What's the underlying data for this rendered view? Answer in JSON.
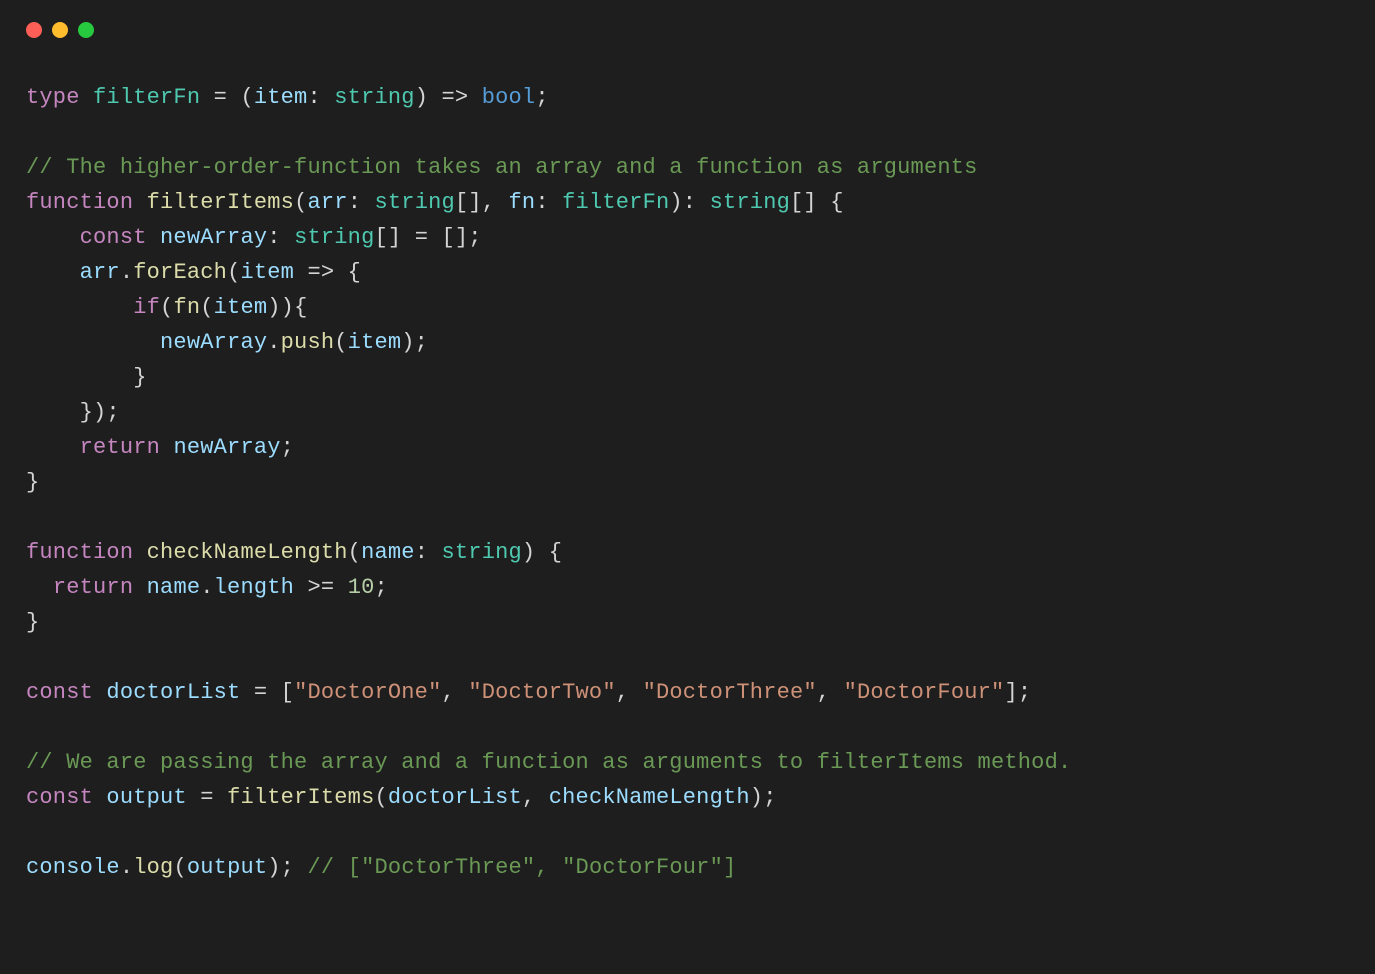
{
  "window": {
    "dots": [
      "red",
      "yellow",
      "green"
    ]
  },
  "code": {
    "tokens": [
      [
        {
          "t": "type",
          "c": "kw"
        },
        {
          "t": " ",
          "c": "punc"
        },
        {
          "t": "filterFn",
          "c": "type"
        },
        {
          "t": " = (",
          "c": "punc"
        },
        {
          "t": "item",
          "c": "var"
        },
        {
          "t": ": ",
          "c": "punc"
        },
        {
          "t": "string",
          "c": "type"
        },
        {
          "t": ") => ",
          "c": "punc"
        },
        {
          "t": "bool",
          "c": "bool"
        },
        {
          "t": ";",
          "c": "punc"
        }
      ],
      [],
      [
        {
          "t": "// The higher-order-function takes an array and a function as arguments",
          "c": "comment"
        }
      ],
      [
        {
          "t": "function",
          "c": "kw"
        },
        {
          "t": " ",
          "c": "punc"
        },
        {
          "t": "filterItems",
          "c": "fn"
        },
        {
          "t": "(",
          "c": "punc"
        },
        {
          "t": "arr",
          "c": "var"
        },
        {
          "t": ": ",
          "c": "punc"
        },
        {
          "t": "string",
          "c": "type"
        },
        {
          "t": "[], ",
          "c": "punc"
        },
        {
          "t": "fn",
          "c": "var"
        },
        {
          "t": ": ",
          "c": "punc"
        },
        {
          "t": "filterFn",
          "c": "type"
        },
        {
          "t": "): ",
          "c": "punc"
        },
        {
          "t": "string",
          "c": "type"
        },
        {
          "t": "[] {",
          "c": "punc"
        }
      ],
      [
        {
          "t": "    ",
          "c": "punc"
        },
        {
          "t": "const",
          "c": "kw"
        },
        {
          "t": " ",
          "c": "punc"
        },
        {
          "t": "newArray",
          "c": "var"
        },
        {
          "t": ": ",
          "c": "punc"
        },
        {
          "t": "string",
          "c": "type"
        },
        {
          "t": "[] = [];",
          "c": "punc"
        }
      ],
      [
        {
          "t": "    ",
          "c": "punc"
        },
        {
          "t": "arr",
          "c": "var"
        },
        {
          "t": ".",
          "c": "punc"
        },
        {
          "t": "forEach",
          "c": "fn"
        },
        {
          "t": "(",
          "c": "punc"
        },
        {
          "t": "item",
          "c": "var"
        },
        {
          "t": " => {",
          "c": "punc"
        }
      ],
      [
        {
          "t": "        ",
          "c": "punc"
        },
        {
          "t": "if",
          "c": "kw"
        },
        {
          "t": "(",
          "c": "punc"
        },
        {
          "t": "fn",
          "c": "fn"
        },
        {
          "t": "(",
          "c": "punc"
        },
        {
          "t": "item",
          "c": "var"
        },
        {
          "t": ")){",
          "c": "punc"
        }
      ],
      [
        {
          "t": "          ",
          "c": "punc"
        },
        {
          "t": "newArray",
          "c": "var"
        },
        {
          "t": ".",
          "c": "punc"
        },
        {
          "t": "push",
          "c": "fn"
        },
        {
          "t": "(",
          "c": "punc"
        },
        {
          "t": "item",
          "c": "var"
        },
        {
          "t": ");",
          "c": "punc"
        }
      ],
      [
        {
          "t": "        }",
          "c": "punc"
        }
      ],
      [
        {
          "t": "    });",
          "c": "punc"
        }
      ],
      [
        {
          "t": "    ",
          "c": "punc"
        },
        {
          "t": "return",
          "c": "kw"
        },
        {
          "t": " ",
          "c": "punc"
        },
        {
          "t": "newArray",
          "c": "var"
        },
        {
          "t": ";",
          "c": "punc"
        }
      ],
      [
        {
          "t": "}",
          "c": "punc"
        }
      ],
      [],
      [
        {
          "t": "function",
          "c": "kw"
        },
        {
          "t": " ",
          "c": "punc"
        },
        {
          "t": "checkNameLength",
          "c": "fn"
        },
        {
          "t": "(",
          "c": "punc"
        },
        {
          "t": "name",
          "c": "var"
        },
        {
          "t": ": ",
          "c": "punc"
        },
        {
          "t": "string",
          "c": "type"
        },
        {
          "t": ") {",
          "c": "punc"
        }
      ],
      [
        {
          "t": "  ",
          "c": "punc"
        },
        {
          "t": "return",
          "c": "kw"
        },
        {
          "t": " ",
          "c": "punc"
        },
        {
          "t": "name",
          "c": "var"
        },
        {
          "t": ".",
          "c": "punc"
        },
        {
          "t": "length",
          "c": "var"
        },
        {
          "t": " >= ",
          "c": "punc"
        },
        {
          "t": "10",
          "c": "num"
        },
        {
          "t": ";",
          "c": "punc"
        }
      ],
      [
        {
          "t": "}",
          "c": "punc"
        }
      ],
      [],
      [
        {
          "t": "const",
          "c": "kw"
        },
        {
          "t": " ",
          "c": "punc"
        },
        {
          "t": "doctorList",
          "c": "var"
        },
        {
          "t": " = [",
          "c": "punc"
        },
        {
          "t": "\"DoctorOne\"",
          "c": "str"
        },
        {
          "t": ", ",
          "c": "punc"
        },
        {
          "t": "\"DoctorTwo\"",
          "c": "str"
        },
        {
          "t": ", ",
          "c": "punc"
        },
        {
          "t": "\"DoctorThree\"",
          "c": "str"
        },
        {
          "t": ", ",
          "c": "punc"
        },
        {
          "t": "\"DoctorFour\"",
          "c": "str"
        },
        {
          "t": "];",
          "c": "punc"
        }
      ],
      [],
      [
        {
          "t": "// We are passing the array and a function as arguments to filterItems method.",
          "c": "comment"
        }
      ],
      [
        {
          "t": "const",
          "c": "kw"
        },
        {
          "t": " ",
          "c": "punc"
        },
        {
          "t": "output",
          "c": "var"
        },
        {
          "t": " = ",
          "c": "punc"
        },
        {
          "t": "filterItems",
          "c": "fn"
        },
        {
          "t": "(",
          "c": "punc"
        },
        {
          "t": "doctorList",
          "c": "var"
        },
        {
          "t": ", ",
          "c": "punc"
        },
        {
          "t": "checkNameLength",
          "c": "var"
        },
        {
          "t": ");",
          "c": "punc"
        }
      ],
      [],
      [
        {
          "t": "console",
          "c": "var"
        },
        {
          "t": ".",
          "c": "punc"
        },
        {
          "t": "log",
          "c": "fn"
        },
        {
          "t": "(",
          "c": "punc"
        },
        {
          "t": "output",
          "c": "var"
        },
        {
          "t": "); ",
          "c": "punc"
        },
        {
          "t": "// [\"DoctorThree\", \"DoctorFour\"]",
          "c": "comment"
        }
      ]
    ]
  }
}
